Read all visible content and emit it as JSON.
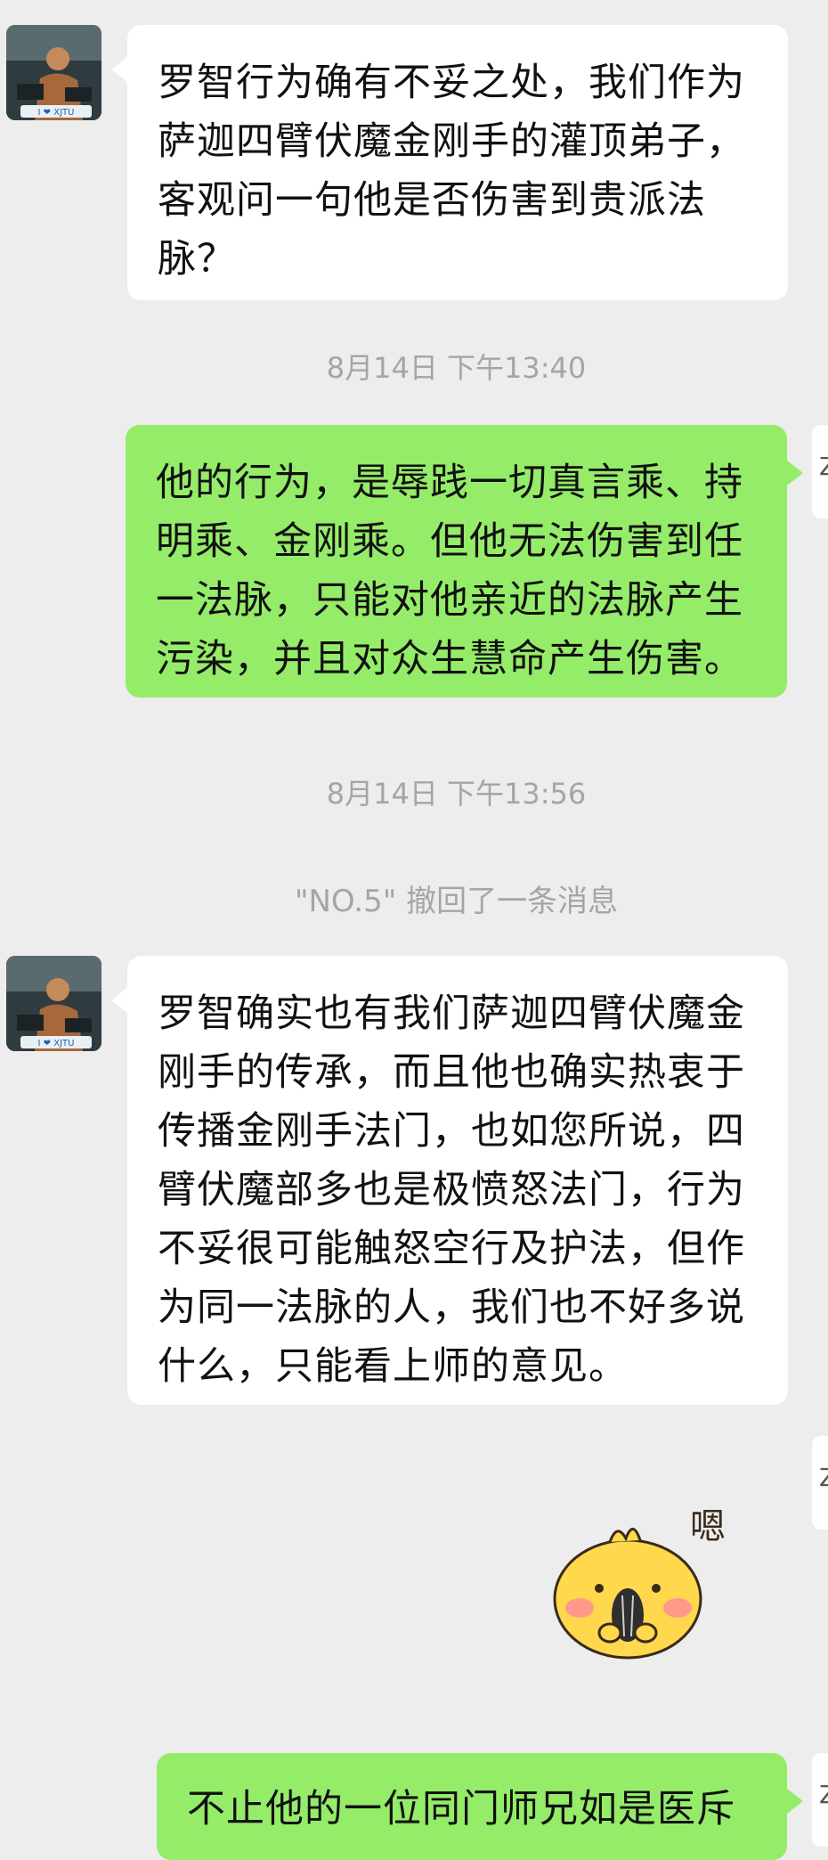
{
  "messages": [
    {
      "text": "罗智行为确有不妥之处，我们作为萨迦四臂伏魔金刚手的灌顶弟子，客观问一句他是否伤害到贵派法脉？"
    },
    {
      "text": "他的行为，是辱践一切真言乘、持明乘、金刚乘。但他无法伤害到任一法脉，只能对他亲近的法脉产生污染，并且对众生慧命产生伤害。"
    },
    {
      "text": "罗智确实也有我们萨迦四臂伏魔金刚手的传承，而且他也确实热衷于传播金刚手法门，也如您所说，四臂伏魔部多也是极愤怒法门，行为不妥很可能触怒空行及护法，但作为同一法脉的人，我们也不好多说什么，只能看上师的意见。"
    },
    {
      "text": "不止他的一位同门师兄如是医斥"
    }
  ],
  "timestamps": [
    "8月14日 下午13:40",
    "8月14日 下午13:56"
  ],
  "system_notice": "\"NO.5\" 撤回了一条消息",
  "avatar": {
    "badge_text": "I ❤ XJTU"
  },
  "sticker": {
    "label": "嗯"
  },
  "colors": {
    "background": "#ededed",
    "incoming_bubble": "#ffffff",
    "outgoing_bubble": "#95ec69",
    "meta_text": "#a5a5a5"
  }
}
